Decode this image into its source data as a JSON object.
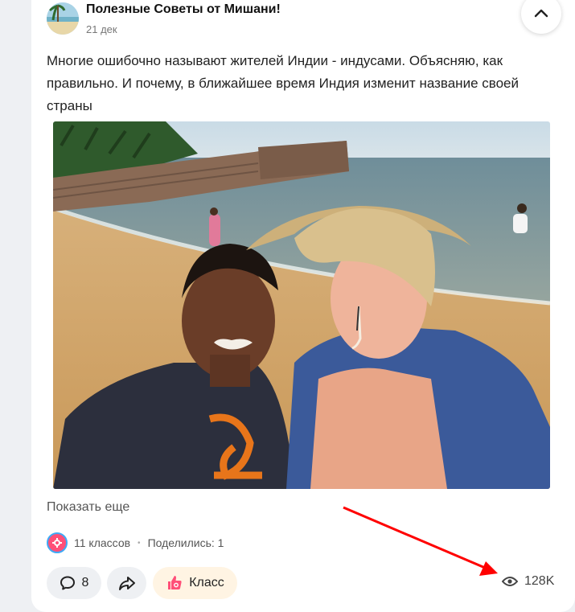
{
  "post": {
    "author": "Полезные Советы от Мишани!",
    "date": "21 дек",
    "text": "Многие ошибочно называют жителей Индии - индусами. Объясняю, как правильно. И почему, в ближайшее время Индия изменит название своей страны",
    "show_more": "Показать еще"
  },
  "reactions": {
    "classes": "11 классов",
    "separator": "•",
    "shared": "Поделились: 1"
  },
  "actions": {
    "comments_count": "8",
    "class_label": "Класс",
    "views": "128K"
  },
  "icons": {
    "collapse": "chevron-up-icon",
    "comment": "comment-bubble-icon",
    "share": "share-arrow-icon",
    "class": "thumb-up-icon",
    "views": "eye-icon"
  },
  "colors": {
    "accent_red": "#ff0000",
    "class_pink": "#ff4f78",
    "class_bg": "#fff4e3"
  }
}
